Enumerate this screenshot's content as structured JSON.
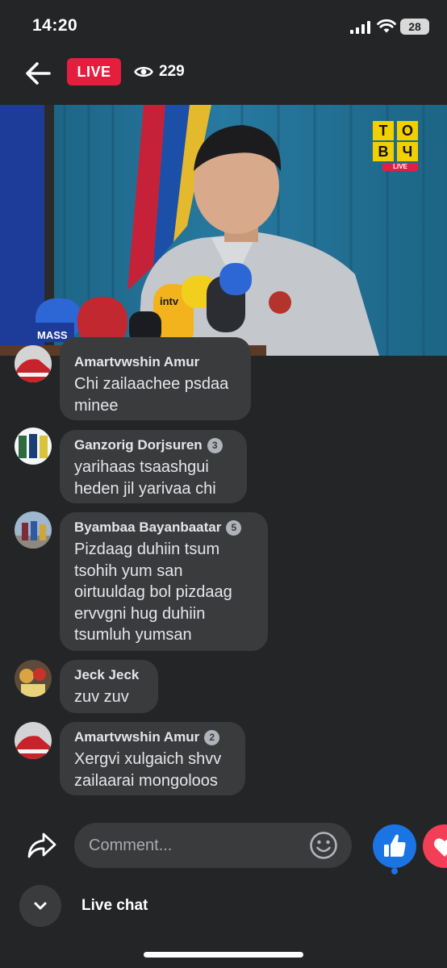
{
  "status_bar": {
    "time": "14:20",
    "battery": "28"
  },
  "header": {
    "live_label": "LIVE",
    "viewer_count": "229"
  },
  "video": {
    "channel_logo_letters": [
      "Т",
      "О",
      "В",
      "Ч"
    ],
    "channel_logo_live": "LIVE",
    "mic_labels": [
      "MASS",
      "intv"
    ]
  },
  "comments": [
    {
      "author": "Amartvwshin Amur",
      "text": "Chi zailaachee psdaa minee"
    },
    {
      "author": "Ganzorig Dorjsuren",
      "badge": "3",
      "text": "yarihaas tsaashgui heden jil yarivaa chi"
    },
    {
      "author": "Byambaa Bayanbaatar",
      "badge": "5",
      "text": "Pizdaag duhiin tsum tsohih yum san oirtuuldag bol pizdaag ervvgni hug duhiin tsumluh yumsan"
    },
    {
      "author": "Jeck Jeck",
      "text": "zuv zuv"
    },
    {
      "author": "Amartvwshin Amur",
      "badge": "2",
      "text": "Xergvi xulgaich shvv zailaarai mongoloos"
    }
  ],
  "composer": {
    "placeholder": "Comment..."
  },
  "footer": {
    "live_chat_label": "Live chat"
  },
  "icons": {
    "back": "back-arrow-icon",
    "eye": "eye-icon",
    "share": "share-icon",
    "emoji": "emoji-icon",
    "like": "thumbs-up-icon",
    "love": "heart-icon",
    "collapse": "chevron-down-icon"
  },
  "colors": {
    "live_red": "#e41e3f",
    "like_blue": "#1b74e4",
    "love_pink": "#f33e58",
    "bubble": "#3a3b3c",
    "background": "#242526"
  }
}
